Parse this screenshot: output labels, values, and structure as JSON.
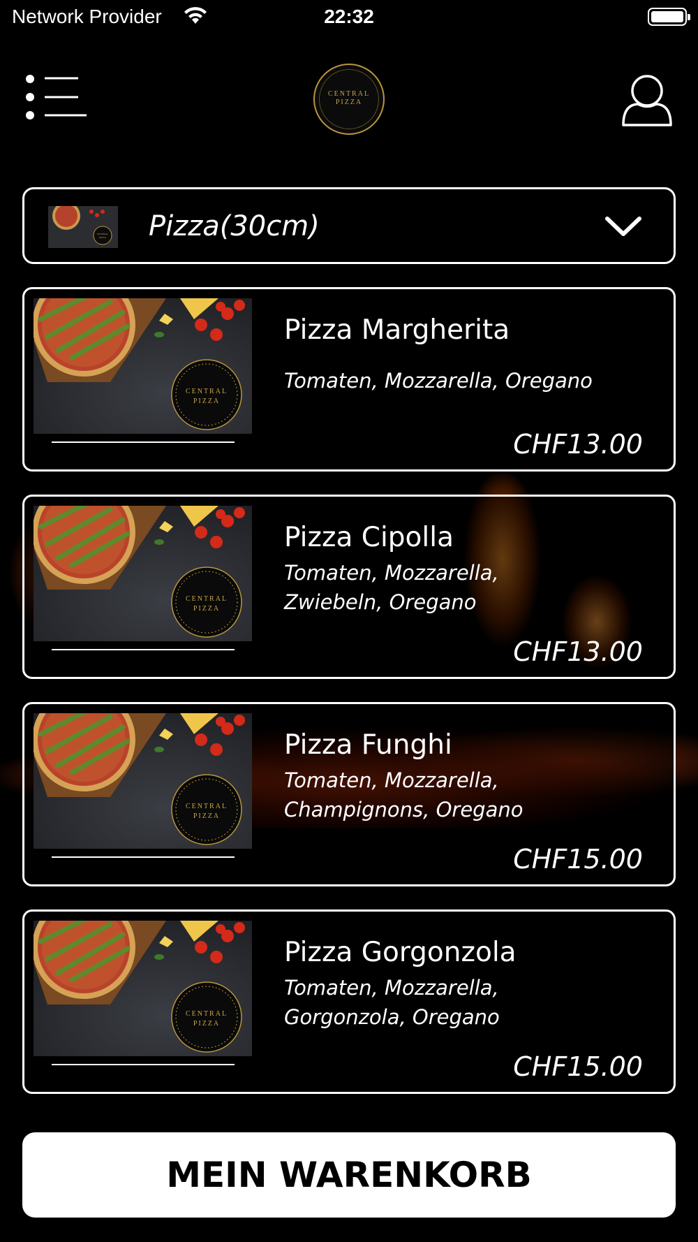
{
  "status_bar": {
    "carrier": "Network Provider",
    "time": "22:32",
    "battery_level": 1.0
  },
  "header": {
    "menu_icon": "menu-icon",
    "logo_text": "CENTRAL\nPIZZA",
    "profile_icon": "user-icon"
  },
  "category": {
    "label": "Pizza(30cm)",
    "thumb_logo_text": "CENTRAL\nPIZZA",
    "chevron_icon": "chevron-down-icon"
  },
  "products": [
    {
      "name": "Pizza Margherita",
      "description": "Tomaten, Mozzarella, Oregano",
      "price": "CHF13.00",
      "image_logo_text": "CENTRAL\nPIZZA"
    },
    {
      "name": "Pizza Cipolla",
      "description": "Tomaten, Mozzarella,\nZwiebeln, Oregano",
      "price": "CHF13.00",
      "image_logo_text": "CENTRAL\nPIZZA"
    },
    {
      "name": "Pizza Funghi",
      "description": "Tomaten, Mozzarella,\nChampignons, Oregano",
      "price": "CHF15.00",
      "image_logo_text": "CENTRAL\nPIZZA"
    },
    {
      "name": "Pizza Gorgonzola",
      "description": "Tomaten, Mozzarella,\nGorgonzola, Oregano",
      "price": "CHF15.00",
      "image_logo_text": "CENTRAL\nPIZZA"
    }
  ],
  "cart": {
    "label": "MEIN WARENKORB"
  },
  "colors": {
    "background": "#000000",
    "accent_gold": "#b8963e",
    "text": "#ffffff",
    "button_bg": "#ffffff"
  }
}
